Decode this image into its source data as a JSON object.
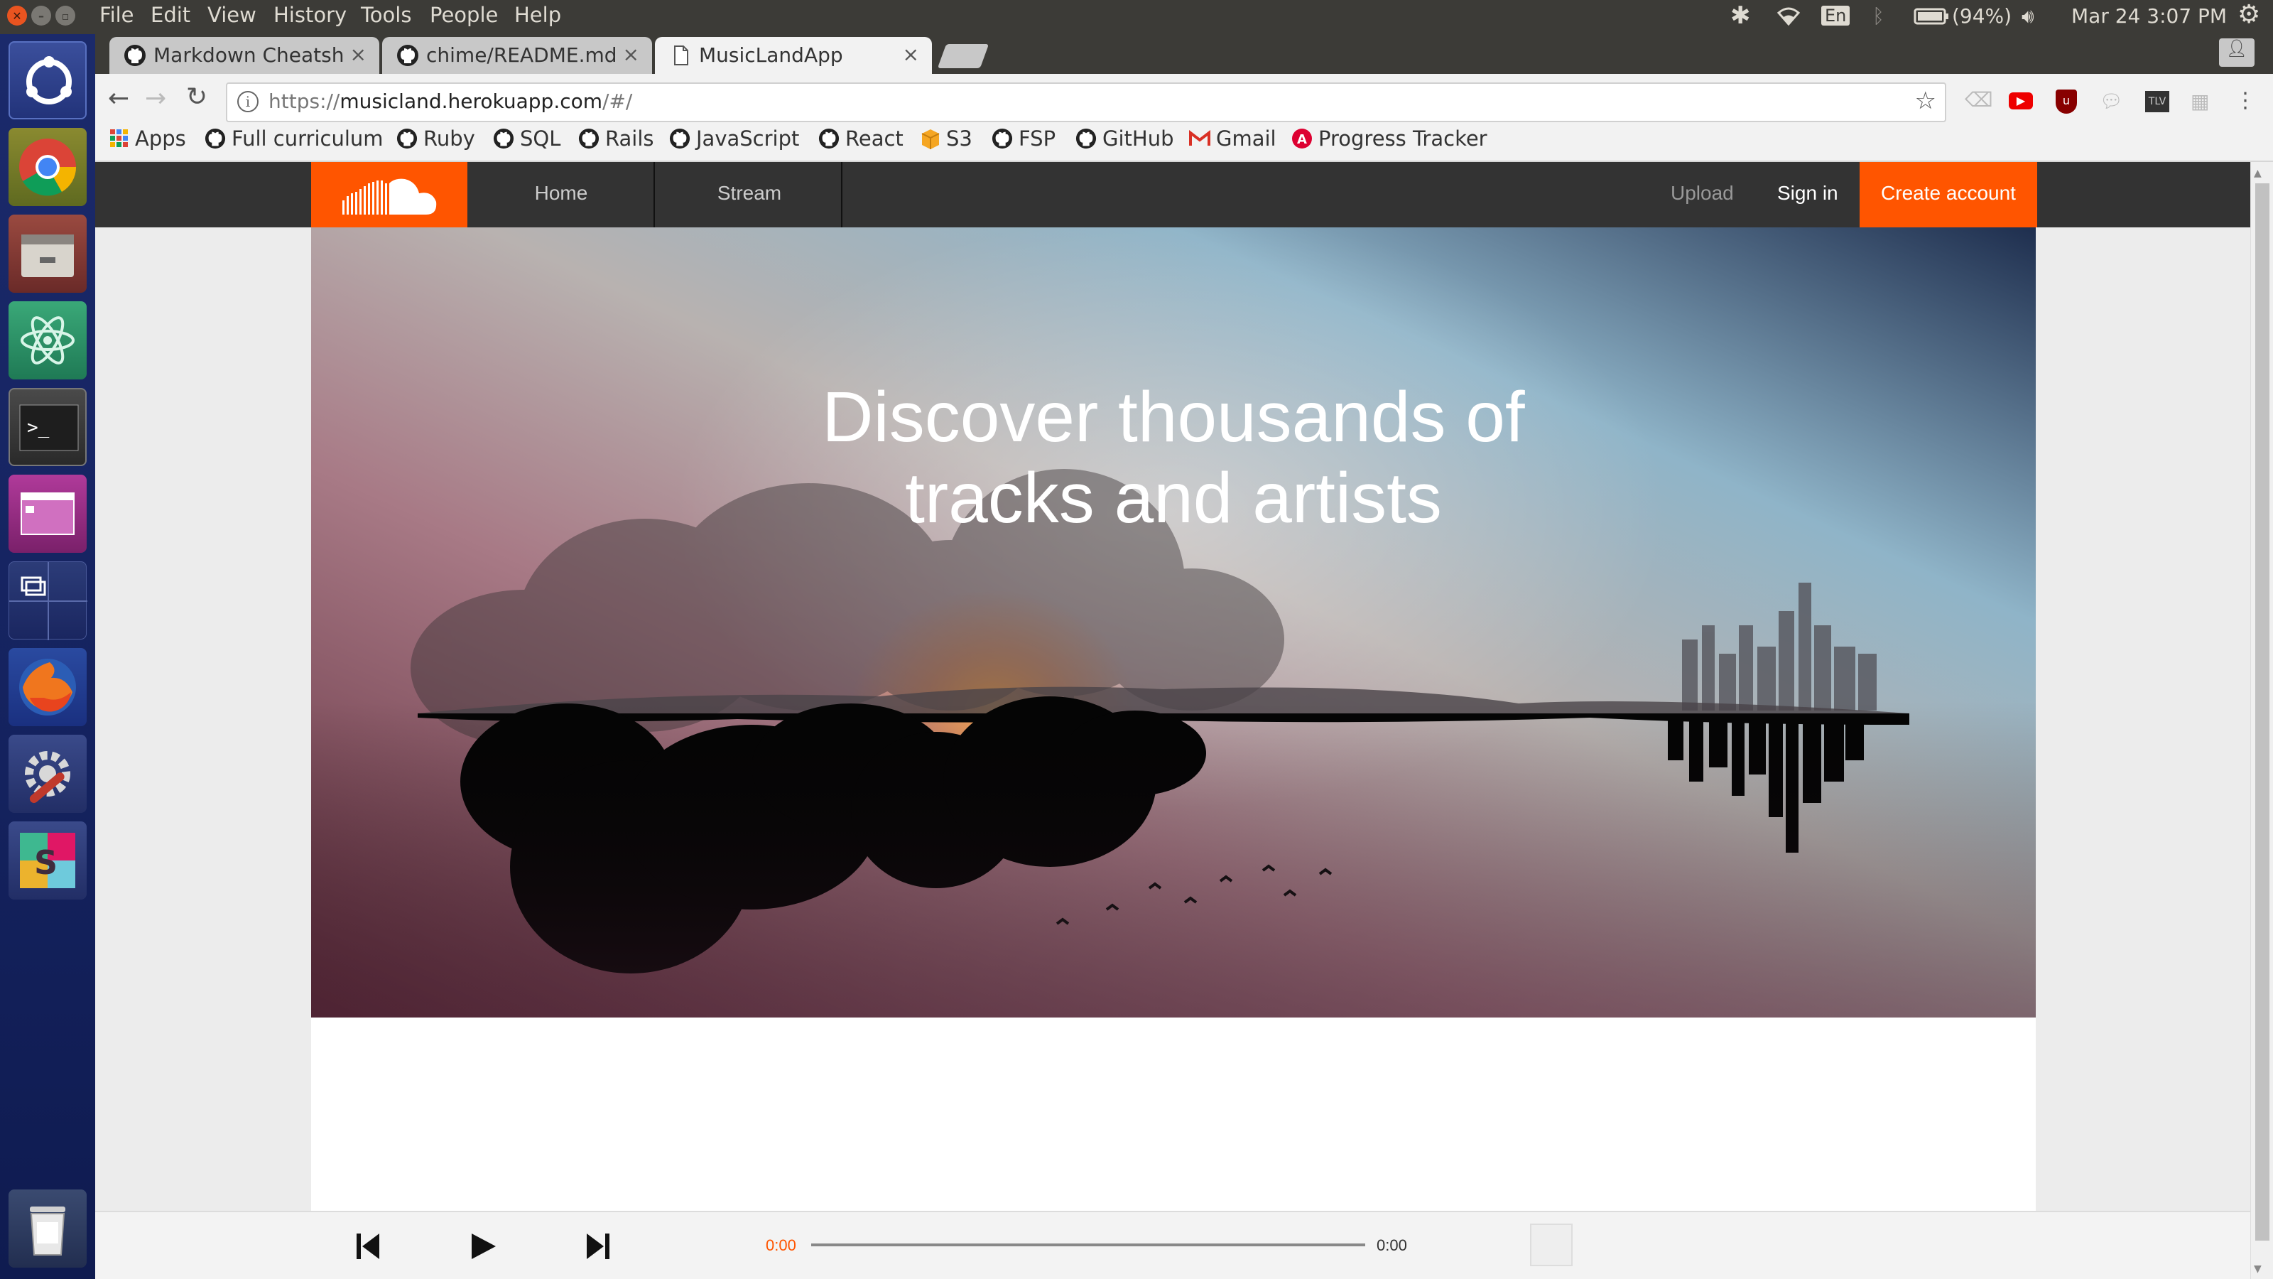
{
  "os": {
    "menu": [
      "File",
      "Edit",
      "View",
      "History",
      "Tools",
      "People",
      "Help"
    ],
    "language": "En",
    "battery": "(94%)",
    "datetime": "Mar 24  3:07 PM"
  },
  "launcher": [
    "ubuntu-dash-icon",
    "chrome-icon",
    "files-icon",
    "atom-icon",
    "terminal-icon",
    "workspace-icon",
    "window-switcher-icon",
    "firefox-icon",
    "settings-icon",
    "slack-icon",
    "trash-icon"
  ],
  "browser": {
    "tabs": [
      {
        "title": "Markdown Cheatsh",
        "icon": "github-icon"
      },
      {
        "title": "chime/README.md",
        "icon": "github-icon"
      },
      {
        "title": "MusicLandApp",
        "icon": "page-icon",
        "active": true
      }
    ],
    "url_host": "https://",
    "url_domain": "musicland.herokuapp.com",
    "url_path": "/#/",
    "bookmarks": [
      "Apps",
      "Full curriculum",
      "Ruby",
      "SQL",
      "Rails",
      "JavaScript",
      "React",
      "S3",
      "FSP",
      "GitHub",
      "Gmail",
      "Progress Tracker"
    ]
  },
  "site": {
    "nav": {
      "home": "Home",
      "stream": "Stream",
      "upload": "Upload",
      "signin": "Sign in",
      "create": "Create account"
    },
    "hero_line1": "Discover thousands of",
    "hero_line2": "tracks and artists",
    "brand_color": "#ff5500"
  },
  "player": {
    "current_time": "0:00",
    "duration": "0:00",
    "progress": 0
  }
}
